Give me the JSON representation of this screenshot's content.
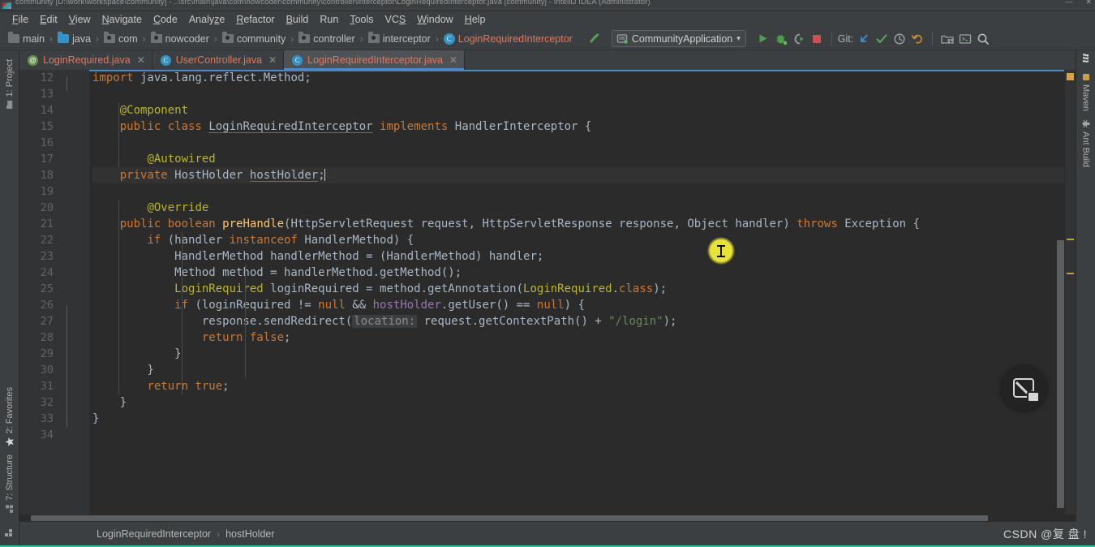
{
  "window": {
    "title": "community [D:\\work\\workspace\\community] - ..\\src\\main\\java\\com\\nowcoder\\community\\controller\\interceptor\\LoginRequiredInterceptor.java [community] - IntelliJ IDEA (Administrator)",
    "minimize": "—",
    "close": "✕"
  },
  "menu": {
    "items": [
      {
        "label": "File"
      },
      {
        "label": "Edit"
      },
      {
        "label": "View"
      },
      {
        "label": "Navigate"
      },
      {
        "label": "Code"
      },
      {
        "label": "Analyze"
      },
      {
        "label": "Refactor"
      },
      {
        "label": "Build"
      },
      {
        "label": "Run"
      },
      {
        "label": "Tools"
      },
      {
        "label": "VCS"
      },
      {
        "label": "Window"
      },
      {
        "label": "Help"
      }
    ]
  },
  "navbar": {
    "breadcrumbs": [
      {
        "label": "main",
        "icon": "folder-icon",
        "kind": "folder"
      },
      {
        "label": "java",
        "icon": "source-folder-icon",
        "kind": "folder-blue"
      },
      {
        "label": "com",
        "icon": "package-icon",
        "kind": "package"
      },
      {
        "label": "nowcoder",
        "icon": "package-icon",
        "kind": "package"
      },
      {
        "label": "community",
        "icon": "package-icon",
        "kind": "package"
      },
      {
        "label": "controller",
        "icon": "package-icon",
        "kind": "package"
      },
      {
        "label": "interceptor",
        "icon": "package-icon",
        "kind": "package"
      },
      {
        "label": "LoginRequiredInterceptor",
        "icon": "class-icon",
        "kind": "class"
      }
    ],
    "separator": "›",
    "hammer_icon": "build-hammer-icon",
    "run_config": {
      "label": "CommunityApplication",
      "icon": "spring-boot-icon",
      "chevron": "▾"
    },
    "buttons": [
      {
        "name": "run-button",
        "icon": "run-triangle-icon"
      },
      {
        "name": "debug-button",
        "icon": "debug-bug-icon"
      },
      {
        "name": "run-with-coverage-button",
        "icon": "coverage-icon"
      },
      {
        "name": "stop-button",
        "icon": "stop-square-icon"
      }
    ],
    "git_label": "Git:",
    "git_buttons": [
      {
        "name": "git-update-button",
        "icon": "update-project-arrow-icon"
      },
      {
        "name": "git-commit-button",
        "icon": "commit-check-icon"
      },
      {
        "name": "git-history-button",
        "icon": "history-clock-icon"
      },
      {
        "name": "git-rollback-button",
        "icon": "rollback-undo-icon"
      }
    ],
    "right_buttons": [
      {
        "name": "project-structure-button",
        "icon": "project-structure-icon"
      },
      {
        "name": "terminal-button",
        "icon": "terminal-icon"
      },
      {
        "name": "search-everywhere-button",
        "icon": "search-icon"
      }
    ]
  },
  "tabs": [
    {
      "label": "LoginRequired.java",
      "icon": "annotation-icon",
      "glyph": "@",
      "active": false,
      "close": "✕"
    },
    {
      "label": "UserController.java",
      "icon": "class-icon",
      "glyph": "C",
      "active": false,
      "close": "✕"
    },
    {
      "label": "LoginRequiredInterceptor.java",
      "icon": "class-icon",
      "glyph": "C",
      "active": true,
      "close": "✕"
    }
  ],
  "left_stripe": [
    {
      "label": "1: Project",
      "icon": "project-folder-icon"
    },
    {
      "label": "2: Favorites",
      "icon": "favorites-star-icon"
    },
    {
      "label": "7: Structure",
      "icon": "structure-icon"
    }
  ],
  "right_stripe": [
    {
      "label": "Maven",
      "icon": "maven-m-icon"
    },
    {
      "label": "Ant Build",
      "icon": "ant-icon"
    }
  ],
  "editor": {
    "first_line_number": 12,
    "lines": [
      {
        "n": 12,
        "text": "import java.lang.reflect.Method;"
      },
      {
        "n": 13,
        "text": ""
      },
      {
        "n": 14,
        "text": "@Component"
      },
      {
        "n": 15,
        "text": "public class LoginRequiredInterceptor implements HandlerInterceptor {"
      },
      {
        "n": 16,
        "text": ""
      },
      {
        "n": 17,
        "text": "    @Autowired"
      },
      {
        "n": 18,
        "text": "    private HostHolder hostHolder;"
      },
      {
        "n": 19,
        "text": ""
      },
      {
        "n": 20,
        "text": "    @Override"
      },
      {
        "n": 21,
        "text": "    public boolean preHandle(HttpServletRequest request, HttpServletResponse response, Object handler) throws Exception {"
      },
      {
        "n": 22,
        "text": "        if (handler instanceof HandlerMethod) {"
      },
      {
        "n": 23,
        "text": "            HandlerMethod handlerMethod = (HandlerMethod) handler;"
      },
      {
        "n": 24,
        "text": "            Method method = handlerMethod.getMethod();"
      },
      {
        "n": 25,
        "text": "            LoginRequired loginRequired = method.getAnnotation(LoginRequired.class);"
      },
      {
        "n": 26,
        "text": "            if (loginRequired != null && hostHolder.getUser() == null) {"
      },
      {
        "n": 27,
        "text": "                response.sendRedirect( location: request.getContextPath() + \"/login\");"
      },
      {
        "n": 28,
        "text": "                return false;"
      },
      {
        "n": 29,
        "text": "            }"
      },
      {
        "n": 30,
        "text": "        }"
      },
      {
        "n": 31,
        "text": "        return true;"
      },
      {
        "n": 32,
        "text": "    }"
      },
      {
        "n": 33,
        "text": "}"
      },
      {
        "n": 34,
        "text": ""
      }
    ],
    "parameter_hint": "location:",
    "cursor_line": 18,
    "gutter_icons": [
      {
        "line": 18,
        "icon": "intention-bulb-icon"
      },
      {
        "line": 21,
        "icon": "override-method-icon"
      }
    ]
  },
  "status_bar": {
    "toggle_icon": "show-tool-windows-icon",
    "breadcrumb": [
      {
        "label": "LoginRequiredInterceptor"
      },
      {
        "label": "hostHolder"
      }
    ],
    "separator": "›",
    "watermark": "CSDN @复 盘 !"
  },
  "floating_button": {
    "name": "restore-window-button",
    "icon": "restore-down-icon"
  },
  "colors": {
    "background": "#2b2b2b",
    "chrome": "#3c3f41",
    "gutter": "#313335",
    "accent_blue": "#4a88c7",
    "tab_text": "#e8745a",
    "keyword": "#cc7832",
    "annotation": "#bbb529",
    "string": "#6a8759",
    "method": "#ffc66d",
    "bottom_band": "#2dbd9a"
  }
}
